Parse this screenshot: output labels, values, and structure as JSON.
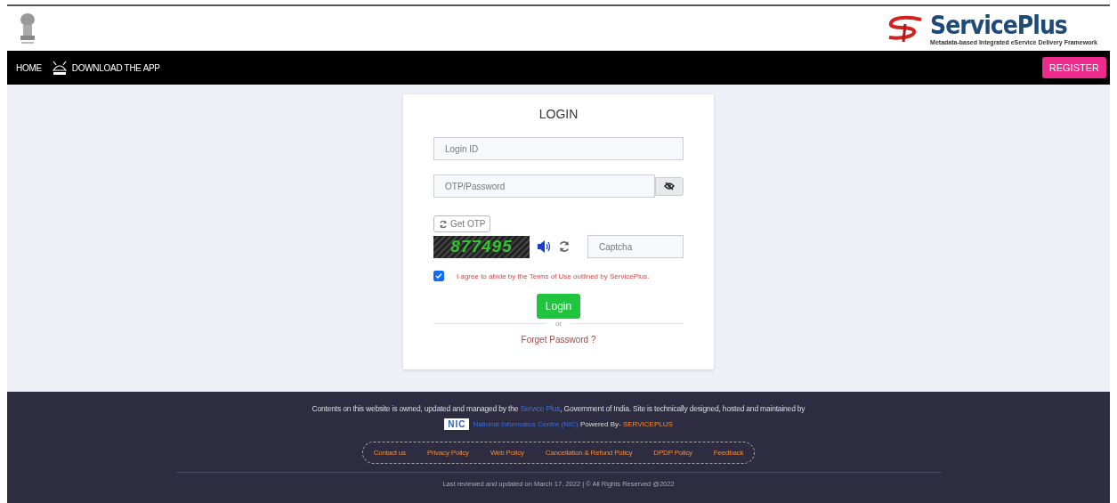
{
  "header": {
    "logo_title": "ServicePlus",
    "logo_tagline": "Metadata-based Integrated eService Delivery Framework"
  },
  "nav": {
    "items": [
      {
        "kind": "text",
        "label": "HOME"
      },
      {
        "kind": "app",
        "label": "DOWNLOAD THE APP"
      }
    ],
    "register": "REGISTER"
  },
  "login": {
    "title": "LOGIN",
    "login_id": {
      "placeholder": "Login ID"
    },
    "password": {
      "placeholder": "OTP/Password"
    },
    "get_otp": "Get OTP",
    "captcha_code": "877495",
    "captcha": {
      "placeholder": "Captcha"
    },
    "terms": {
      "text": "I agree to abide by the Terms of Use outlined by ServicePlus.",
      "checked": true
    },
    "submit": "Login",
    "separator": "or",
    "forgot": "Forget Password ?"
  },
  "footer": {
    "notice": [
      {
        "kind": "text",
        "text": "Contents on this website is owned, updated and managed by the "
      },
      {
        "kind": "link",
        "text": "Service Plus"
      },
      {
        "kind": "text",
        "text": ", Government of India. Site is technically designed, hosted and maintained by"
      }
    ],
    "nic_logo": "NIC",
    "credit": [
      {
        "kind": "link",
        "text": "National Informatics Centre (NIC)"
      },
      {
        "kind": "text",
        "text": " Powered By- "
      },
      {
        "kind": "brand",
        "text": "SERVICEPLUS"
      }
    ],
    "links": [
      "Contact us",
      "Privacy Policy",
      "Web Policy",
      "Cancellation & Refund Policy",
      "DPDP Policy",
      "Feedback"
    ],
    "copyright": "Last reviewed and updated on March 17, 2022 | © All Rights Reserved @2022"
  }
}
